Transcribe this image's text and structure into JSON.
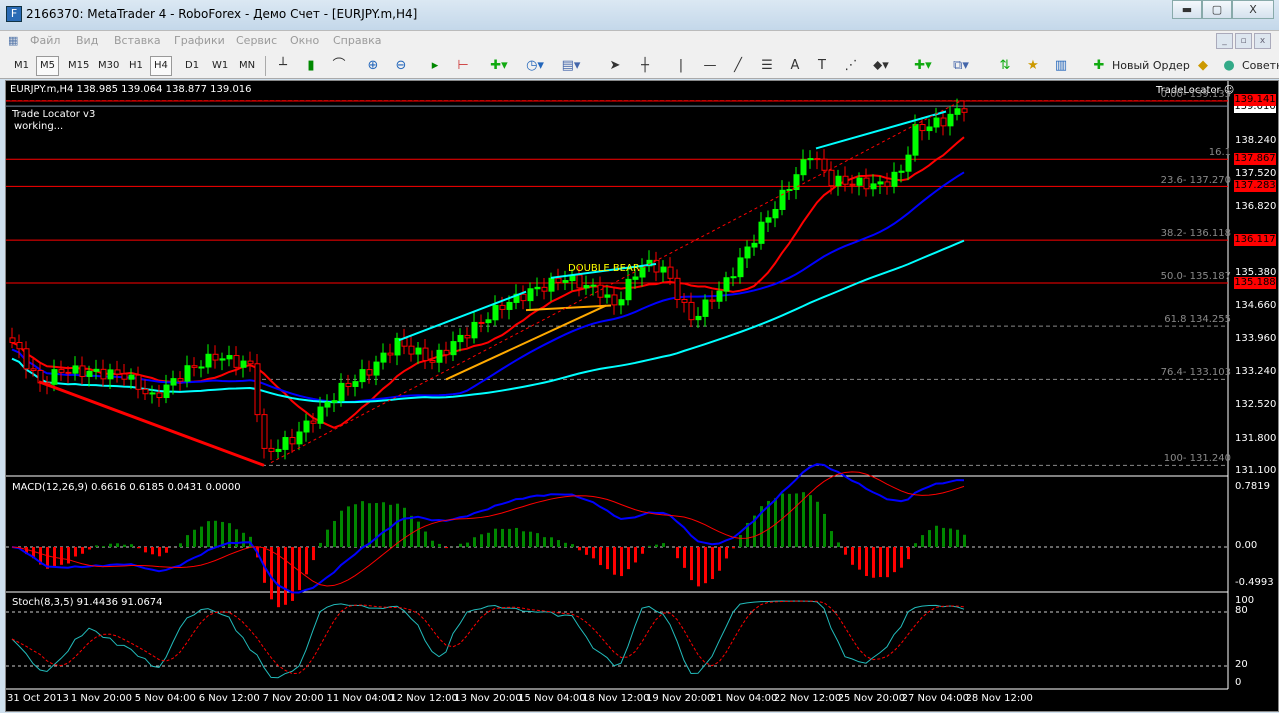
{
  "window": {
    "title": "2166370: MetaTrader 4 - RoboForex - Демо Счет - [EURJPY.m,H4]",
    "minimize": "▬",
    "maximize": "▢",
    "close": "X"
  },
  "menu": [
    "Файл",
    "Вид",
    "Вставка",
    "Графики",
    "Сервис",
    "Окно",
    "Справка"
  ],
  "toolbar": {
    "timeframes": [
      "M1",
      "M5",
      "M15",
      "M30",
      "H1",
      "H4",
      "D1",
      "W1",
      "MN"
    ],
    "active": "H4",
    "new_order": "Новый Ордер",
    "advisors": "Советники"
  },
  "chart": {
    "header": "EURJPY.m,H4  138.985 139.064 138.877 139.016",
    "indicator_name": "Trade Locator v3",
    "indicator_status": "working...",
    "trade_locator_label": "TradeLocator ☺",
    "pattern_label": "DOUBLE BEAR",
    "price_axis": [
      "138.240",
      "137.520",
      "136.820",
      "135.380",
      "134.660",
      "133.960",
      "133.240",
      "132.520",
      "131.800",
      "131.100"
    ],
    "current_price": "139.016",
    "level_tags": [
      "139.141",
      "137.867",
      "137.283",
      "136.117",
      "135.188"
    ],
    "fib_labels": [
      "0.00- 139.133",
      "16.1",
      "23.6- 137.270",
      "38.2- 136.118",
      "50.0- 135.187",
      "61.8 134.255",
      "76.4- 133.103",
      "100- 131.240"
    ],
    "time_axis": [
      "31 Oct 2013",
      "1 Nov 20:00",
      "5 Nov 04:00",
      "6 Nov 12:00",
      "7 Nov 20:00",
      "11 Nov 04:00",
      "12 Nov 12:00",
      "13 Nov 20:00",
      "15 Nov 04:00",
      "18 Nov 12:00",
      "19 Nov 20:00",
      "21 Nov 04:00",
      "22 Nov 12:00",
      "25 Nov 20:00",
      "27 Nov 04:00",
      "28 Nov 12:00"
    ]
  },
  "macd": {
    "label": "MACD(12,26,9) 0.6616 0.6185 0.0431 0.0000",
    "axis": [
      "0.7819",
      "0.00",
      "-0.4993"
    ]
  },
  "stoch": {
    "label": "Stoch(8,3,5) 91.4436 91.0674",
    "axis": [
      "100",
      "80",
      "20",
      "0"
    ]
  },
  "chart_data": {
    "type": "candlestick",
    "symbol": "EURJPY.m",
    "timeframe": "H4",
    "ylim": [
      131.1,
      139.2
    ],
    "close_waypoints": [
      [
        0,
        133.9
      ],
      [
        4,
        133.0
      ],
      [
        7,
        133.3
      ],
      [
        16,
        133.2
      ],
      [
        20,
        132.7
      ],
      [
        25,
        133.3
      ],
      [
        29,
        133.6
      ],
      [
        34,
        133.4
      ],
      [
        36,
        131.5
      ],
      [
        40,
        131.8
      ],
      [
        47,
        132.9
      ],
      [
        51,
        133.3
      ],
      [
        55,
        133.9
      ],
      [
        60,
        133.5
      ],
      [
        64,
        134.0
      ],
      [
        70,
        134.7
      ],
      [
        74,
        135.0
      ],
      [
        79,
        135.3
      ],
      [
        84,
        135.0
      ],
      [
        86,
        134.7
      ],
      [
        90,
        135.6
      ],
      [
        93,
        135.5
      ],
      [
        97,
        134.4
      ],
      [
        99,
        134.7
      ],
      [
        102,
        135.2
      ],
      [
        107,
        136.4
      ],
      [
        111,
        137.3
      ],
      [
        114,
        138.0
      ],
      [
        117,
        137.4
      ],
      [
        124,
        137.3
      ],
      [
        127,
        137.6
      ],
      [
        129,
        138.5
      ],
      [
        133,
        138.7
      ],
      [
        136,
        139.0
      ]
    ],
    "colors": {
      "up": "#00ff00",
      "down": "#ff0000",
      "ma_fast": "#ff0000",
      "ma_mid": "#0000ff",
      "ma_slow": "#00ffff"
    }
  }
}
